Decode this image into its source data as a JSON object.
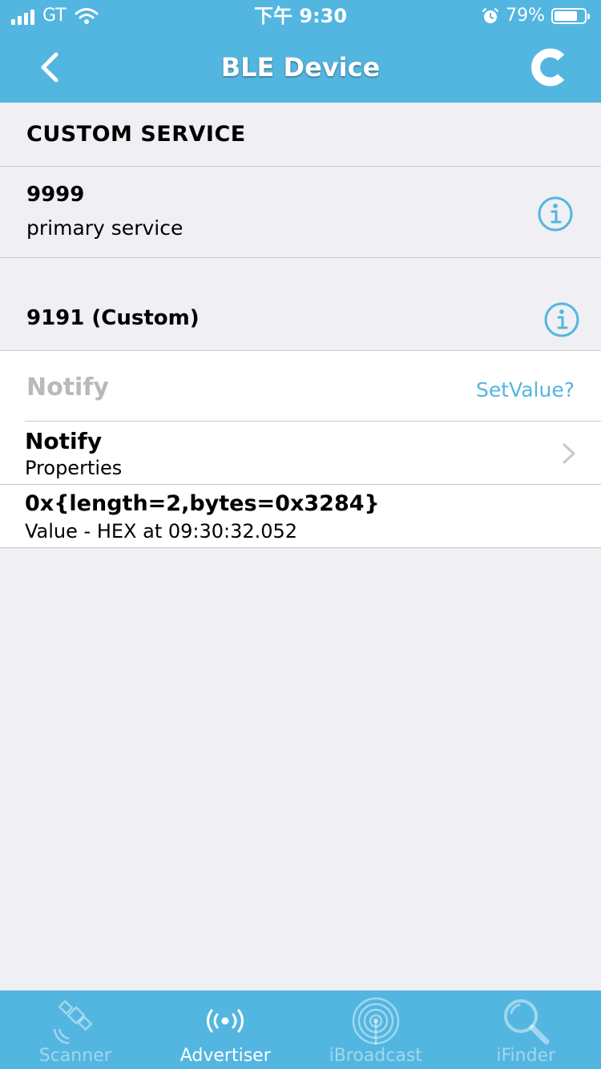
{
  "status_bar": {
    "carrier": "GT",
    "time": "下午 9:30",
    "battery_percent": "79%",
    "battery_level": 0.79
  },
  "nav": {
    "title": "BLE Device",
    "back_icon": "chevron-left-icon",
    "refresh_icon": "refresh-icon"
  },
  "section": {
    "header": "CUSTOM SERVICE"
  },
  "service": {
    "uuid": "9999",
    "type": "primary service"
  },
  "characteristic": {
    "uuid": "9191 (Custom)"
  },
  "notify_section": {
    "label": "Notify",
    "set_value": "SetValue?"
  },
  "properties_row": {
    "value": "Notify",
    "label": "Properties"
  },
  "value_row": {
    "value": "0x{length=2,bytes=0x3284}",
    "label": "Value - HEX at 09:30:32.052"
  },
  "tabs": [
    {
      "label": "Scanner",
      "icon": "satellite-icon",
      "active": false
    },
    {
      "label": "Advertiser",
      "icon": "broadcast-icon",
      "active": true
    },
    {
      "label": "iBroadcast",
      "icon": "radar-icon",
      "active": false
    },
    {
      "label": "iFinder",
      "icon": "magnifier-icon",
      "active": false
    }
  ],
  "colors": {
    "accent": "#53b6e0",
    "background": "#efeff4"
  }
}
